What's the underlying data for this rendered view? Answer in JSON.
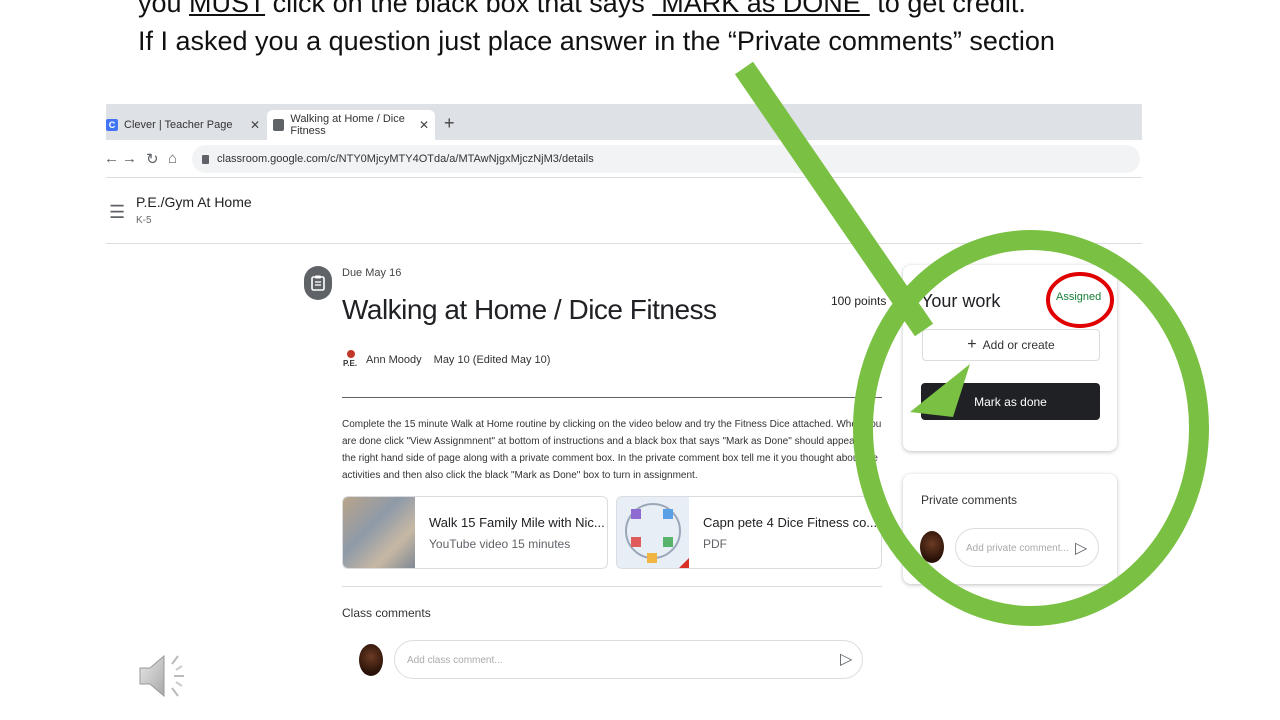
{
  "instructions": {
    "line1_prefix": "you ",
    "line1_must": "MUST",
    "line1_mid": " click on the black box that says ",
    "line1_mark": "“MARK as DONE”",
    "line1_suffix": " to get credit.",
    "line2": "If I asked you a question just place answer in the “Private comments” section"
  },
  "browser": {
    "tabs": [
      {
        "label": "Clever | Teacher Page",
        "favicon": "C"
      },
      {
        "label": "Walking at Home / Dice Fitness"
      }
    ],
    "url": "classroom.google.com/c/NTY0MjcyMTY4OTda/a/MTAwNjgxMjczNjM3/details"
  },
  "classroom": {
    "class_name": "P.E./Gym At Home",
    "section": "K-5"
  },
  "assignment": {
    "due": "Due May 16",
    "title": "Walking at Home / Dice Fitness",
    "points": "100 points",
    "author_logo_text": "P.E.",
    "author": "Ann Moody",
    "date": "May 10 (Edited May 10)",
    "description": "Complete the 15 minute Walk at Home routine by clicking on the video below and try the Fitness Dice attached. When you are done click \"View Assignmnent\" at bottom of instructions and a black box that says \"Mark as Done\" should appear on the right hand side of page along with a private comment box. In the private comment box tell me it you thought about the activities and then also click the black \"Mark as Done\" box to turn in assignment.",
    "attachments": [
      {
        "title": "Walk 15 Family Mile with Nic...",
        "subtitle": "YouTube video   15 minutes"
      },
      {
        "title": "Capn pete 4 Dice Fitness co...",
        "subtitle": "PDF"
      }
    ],
    "class_comments_label": "Class comments",
    "class_comment_placeholder": "Add class comment..."
  },
  "your_work": {
    "title": "Your work",
    "status": "Assigned",
    "add_label": "Add or create",
    "done_label": "Mark as done"
  },
  "private_comments": {
    "title": "Private comments",
    "placeholder": "Add private comment..."
  },
  "colors": {
    "annotation_green": "#7ac143",
    "annotation_red": "#e00000",
    "status_green": "#188038"
  }
}
